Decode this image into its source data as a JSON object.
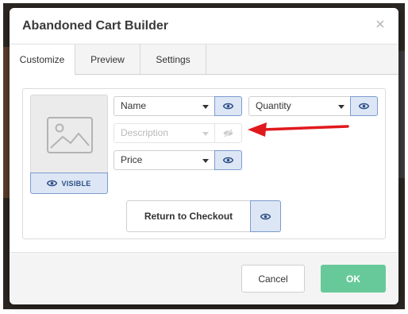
{
  "modal": {
    "title": "Abandoned Cart Builder",
    "close_glyph": "×"
  },
  "tabs": [
    {
      "label": "Customize",
      "active": true
    },
    {
      "label": "Preview",
      "active": false
    },
    {
      "label": "Settings",
      "active": false
    }
  ],
  "image_placeholder": {
    "icon": "image-icon",
    "visibility_label": "VISIBLE"
  },
  "fields": {
    "name": {
      "value": "Name",
      "visible": true
    },
    "quantity": {
      "value": "Quantity",
      "visible": true
    },
    "description": {
      "value": "Description",
      "visible": false
    },
    "price": {
      "value": "Price",
      "visible": true
    }
  },
  "return_button": {
    "label": "Return to Checkout",
    "visible": true
  },
  "footer": {
    "cancel_label": "Cancel",
    "ok_label": "OK"
  },
  "colors": {
    "accent_blue": "#7d9bd0",
    "accent_blue_bg": "#dce6f5",
    "ok_green": "#67c999",
    "arrow_red": "#e0191d"
  }
}
